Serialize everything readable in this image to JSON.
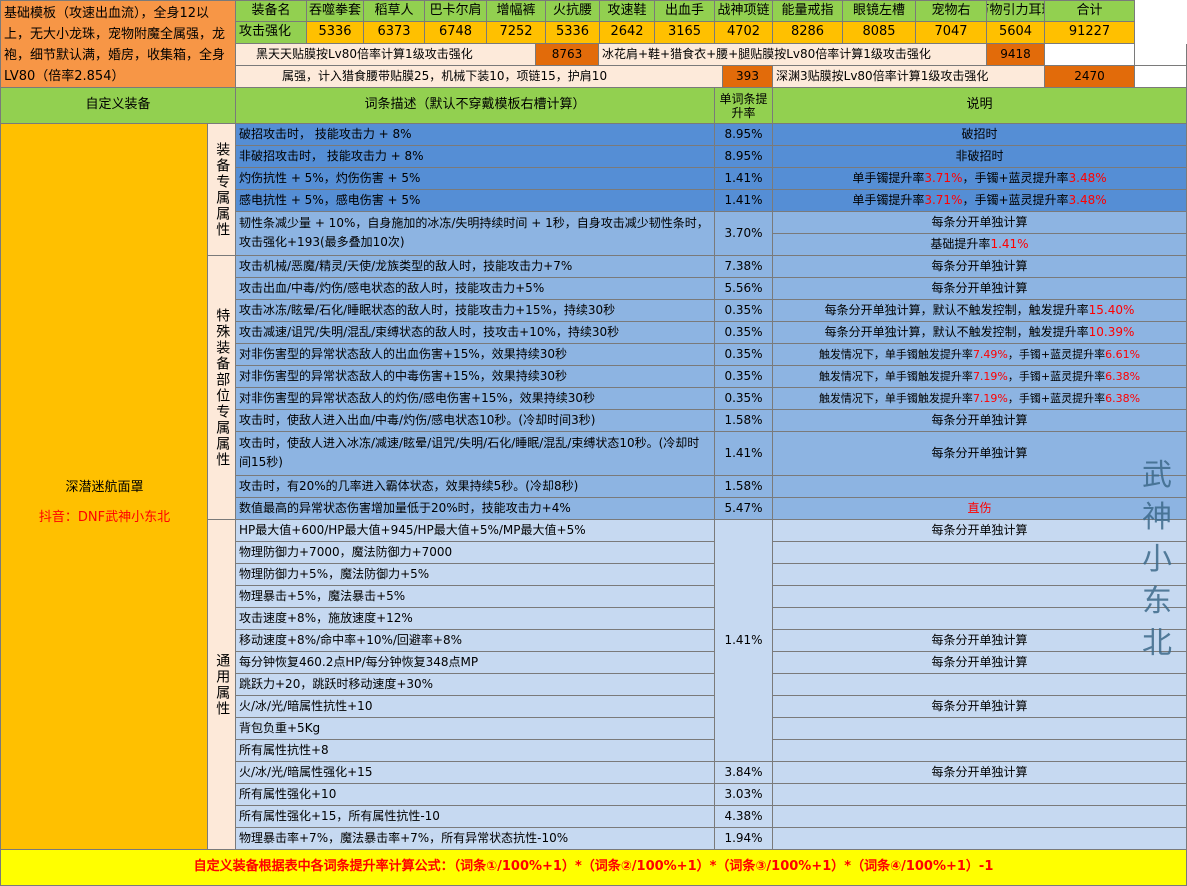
{
  "base_template": "基础模板（攻速出血流），全身12以上，无大小龙珠，宠物附魔全属强，龙袍，细节默认满，婚房，收集箱，全身LV80（倍率2.854）",
  "equipment_row": {
    "header_label": "装备名",
    "names": [
      "吞噬拳套",
      "稻草人",
      "巴卡尔肩",
      "增幅裤",
      "火抗腰",
      "攻速鞋",
      "出血手",
      "战神项链",
      "能量戒指",
      "眼镜左槽",
      "宠物右",
      "万物引力耳环",
      "合计"
    ],
    "value_label": "攻击强化",
    "values": [
      "5336",
      "6373",
      "6748",
      "7252",
      "5336",
      "2642",
      "3165",
      "4702",
      "8286",
      "8085",
      "7047",
      "5604",
      "91227"
    ]
  },
  "notes": {
    "film1_label": "黑天天贴膜按Lv80倍率计算1级攻击强化",
    "film1_value": "8763",
    "film2_label": "冰花肩+鞋+猎食衣+腰+腿贴膜按Lv80倍率计算1级攻击强化",
    "film2_value": "9418",
    "misc_label": "属强，计入猎食腰带贴膜25，机械下装10，项链15，护肩10",
    "misc_value": "393",
    "film3_label": "深渊3贴膜按Lv80倍率计算1级攻击强化",
    "film3_value": "2470"
  },
  "headers": {
    "custom": "自定义装备",
    "desc": "词条描述（默认不穿戴模板右槽计算）",
    "rate": "单词条提升率",
    "explain": "说明"
  },
  "item": {
    "name": "深潜迷航面罩",
    "author": "抖音：DNF武神小东北"
  },
  "groups": {
    "g1": "装备专属属性",
    "g2": "特殊装备部位专属属性",
    "g3": "通用属性"
  },
  "watermark": "武神小东北",
  "rows": {
    "r1": {
      "desc": "破招攻击时， 技能攻击力 + 8%",
      "rate": "8.95%",
      "note": "破招时"
    },
    "r2": {
      "desc": "非破招攻击时， 技能攻击力 + 8%",
      "rate": "8.95%",
      "note": "非破招时"
    },
    "r3": {
      "desc": "灼伤抗性 + 5%，灼伤伤害 + 5%",
      "rate": "1.41%",
      "note_a": "单手镯提升率",
      "note_a_val": "3.71%",
      "note_b": "，手镯+蓝灵提升率",
      "note_b_val": "3.48%"
    },
    "r4": {
      "desc": "感电抗性 + 5%，感电伤害 + 5%",
      "rate": "1.41%",
      "note_a": "单手镯提升率",
      "note_a_val": "3.71%",
      "note_b": "，手镯+蓝灵提升率",
      "note_b_val": "3.48%"
    },
    "r5": {
      "desc": "韧性条减少量 + 10%，自身施加的冰冻/失明持续时间 + 1秒，自身攻击减少韧性条时，攻击强化+193(最多叠加10次)",
      "rate": "3.70%",
      "note1": "每条分开单独计算",
      "note2_a": "基础提升率",
      "note2_val": "1.41%"
    },
    "r6": {
      "desc": "攻击机械/恶魔/精灵/天使/龙族类型的敌人时，技能攻击力+7%",
      "rate": "7.38%",
      "note": "每条分开单独计算"
    },
    "r7": {
      "desc": "攻击出血/中毒/灼伤/感电状态的敌人时，技能攻击力+5%",
      "rate": "5.56%",
      "note": "每条分开单独计算"
    },
    "r8": {
      "desc": "攻击冰冻/眩晕/石化/睡眠状态的敌人时，技能攻击力+15%，持续30秒",
      "rate": "0.35%",
      "note_a": "每条分开单独计算，默认不触发控制，触发提升率",
      "note_val": "15.40%"
    },
    "r9": {
      "desc": "攻击减速/诅咒/失明/混乱/束缚状态的敌人时，技攻击+10%，持续30秒",
      "rate": "0.35%",
      "note_a": "每条分开单独计算，默认不触发控制，触发提升率",
      "note_val": "10.39%"
    },
    "r10": {
      "desc": "对非伤害型的异常状态敌人的出血伤害+15%，效果持续30秒",
      "rate": "0.35%",
      "note_a": "触发情况下，单手镯触发提升率",
      "note_a_val": "7.49%",
      "note_b": "，手镯+蓝灵提升率",
      "note_b_val": "6.61%"
    },
    "r11": {
      "desc": "对非伤害型的异常状态敌人的中毒伤害+15%，效果持续30秒",
      "rate": "0.35%",
      "note_a": "触发情况下，单手镯触发提升率",
      "note_a_val": "7.19%",
      "note_b": "，手镯+蓝灵提升率",
      "note_b_val": "6.38%"
    },
    "r12": {
      "desc": "对非伤害型的异常状态敌人的灼伤/感电伤害+15%，效果持续30秒",
      "rate": "0.35%",
      "note_a": "触发情况下，单手镯触发提升率",
      "note_a_val": "7.19%",
      "note_b": "，手镯+蓝灵提升率",
      "note_b_val": "6.38%"
    },
    "r13": {
      "desc": "攻击时，使敌人进入出血/中毒/灼伤/感电状态10秒。(冷却时间3秒)",
      "rate": "1.58%",
      "note": "每条分开单独计算"
    },
    "r14": {
      "desc": "攻击时，使敌人进入冰冻/减速/眩晕/诅咒/失明/石化/睡眠/混乱/束缚状态10秒。(冷却时间15秒)",
      "rate": "1.41%",
      "note": "每条分开单独计算"
    },
    "r15": {
      "desc": "攻击时，有20%的几率进入霸体状态，效果持续5秒。(冷却8秒)",
      "rate": "1.58%",
      "note": ""
    },
    "r16": {
      "desc": "数值最高的异常状态伤害增加量低于20%时，技能攻击力+4%",
      "rate": "5.47%",
      "note": "直伤"
    },
    "g3_rows": [
      {
        "desc": "HP最大值+600/HP最大值+945/HP最大值+5%/MP最大值+5%",
        "note": "每条分开单独计算"
      },
      {
        "desc": "物理防御力+7000，魔法防御力+7000",
        "note": ""
      },
      {
        "desc": "物理防御力+5%，魔法防御力+5%",
        "note": ""
      },
      {
        "desc": "物理暴击+5%，魔法暴击+5%",
        "note": ""
      },
      {
        "desc": "攻击速度+8%，施放速度+12%",
        "note": ""
      },
      {
        "desc": "移动速度+8%/命中率+10%/回避率+8%",
        "note": "每条分开单独计算"
      },
      {
        "desc": "每分钟恢复460.2点HP/每分钟恢复348点MP",
        "note": "每条分开单独计算"
      },
      {
        "desc": "跳跃力+20，跳跃时移动速度+30%",
        "note": ""
      },
      {
        "desc": "火/冰/光/暗属性抗性+10",
        "note": "每条分开单独计算"
      },
      {
        "desc": "背包负重+5Kg",
        "note": ""
      },
      {
        "desc": "所有属性抗性+8",
        "note": ""
      }
    ],
    "g3_merged_rate": "1.41%",
    "g3_tail": [
      {
        "desc": "火/冰/光/暗属性强化+15",
        "rate": "3.84%",
        "note": "每条分开单独计算"
      },
      {
        "desc": "所有属性强化+10",
        "rate": "3.03%",
        "note": ""
      },
      {
        "desc": "所有属性强化+15，所有属性抗性-10",
        "rate": "4.38%",
        "note": ""
      },
      {
        "desc": "物理暴击率+7%，魔法暴击率+7%，所有异常状态抗性-10%",
        "rate": "1.94%",
        "note": ""
      }
    ]
  },
  "formula": "自定义装备根据表中各词条提升率计算公式：（词条①/100%+1）*（词条②/100%+1）*（词条③/100%+1）*（词条④/100%+1）-1"
}
